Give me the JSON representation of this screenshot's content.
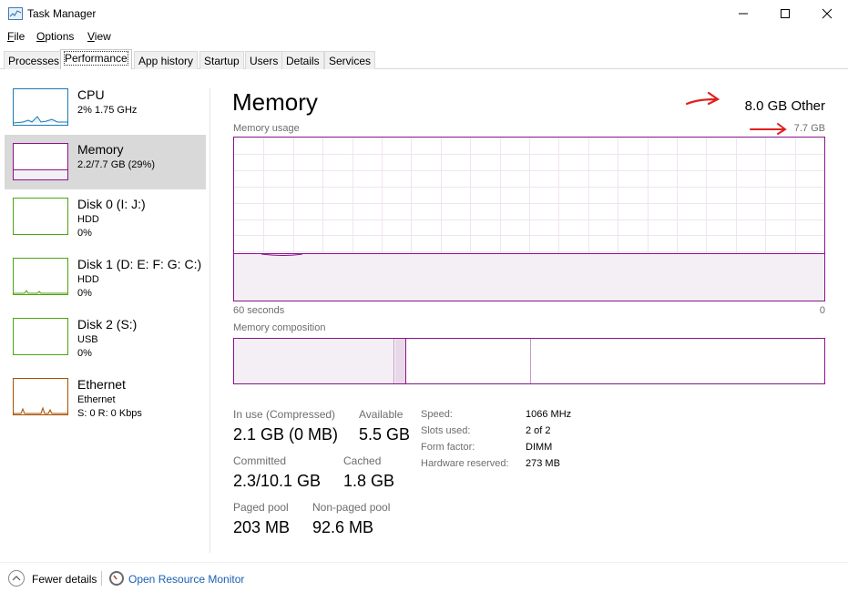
{
  "window": {
    "title": "Task Manager"
  },
  "menu": [
    {
      "label": "File",
      "key": "F",
      "rest": "ile"
    },
    {
      "label": "Options",
      "key": "O",
      "rest": "ptions"
    },
    {
      "label": "View",
      "key": "V",
      "rest": "iew"
    }
  ],
  "tabs": [
    "Processes",
    "Performance",
    "App history",
    "Startup",
    "Users",
    "Details",
    "Services"
  ],
  "active_tab": "Performance",
  "resources": [
    {
      "name": "CPU",
      "line1": "2%  1.75 GHz",
      "line2": "",
      "color": "#1a7ab5"
    },
    {
      "name": "Memory",
      "line1": "2.2/7.7 GB (29%)",
      "line2": "",
      "color": "#8b138b"
    },
    {
      "name": "Disk 0 (I: J:)",
      "line1": "HDD",
      "line2": "0%",
      "color": "#4da60c"
    },
    {
      "name": "Disk 1 (D: E: F: G: C:)",
      "line1": "HDD",
      "line2": "0%",
      "color": "#4da60c"
    },
    {
      "name": "Disk 2 (S:)",
      "line1": "USB",
      "line2": "0%",
      "color": "#4da60c"
    },
    {
      "name": "Ethernet",
      "line1": "Ethernet",
      "line2": "S: 0  R: 0 Kbps",
      "color": "#a74f01"
    }
  ],
  "main": {
    "title": "Memory",
    "total": "8.0 GB Other",
    "usage_label": "Memory usage",
    "usage_max": "7.7 GB",
    "axis_left": "60 seconds",
    "axis_right": "0",
    "composition_label": "Memory composition",
    "usage_fraction": 0.29
  },
  "stats": {
    "in_use_label": "In use (Compressed)",
    "in_use_value": "2.1 GB (0 MB)",
    "available_label": "Available",
    "available_value": "5.5 GB",
    "committed_label": "Committed",
    "committed_value": "2.3/10.1 GB",
    "cached_label": "Cached",
    "cached_value": "1.8 GB",
    "paged_label": "Paged pool",
    "paged_value": "203 MB",
    "nonpaged_label": "Non-paged pool",
    "nonpaged_value": "92.6 MB"
  },
  "specs": [
    {
      "label": "Speed:",
      "value": "1066 MHz"
    },
    {
      "label": "Slots used:",
      "value": "2 of 2"
    },
    {
      "label": "Form factor:",
      "value": "DIMM"
    },
    {
      "label": "Hardware reserved:",
      "value": "273 MB"
    }
  ],
  "footer": {
    "fewer_details": "Fewer details",
    "fewer_key": "d",
    "open_resource_monitor": "Open Resource Monitor"
  },
  "colors": {
    "memory": "#8b138b",
    "annotation": "#e02020",
    "link": "#1a5fb4"
  }
}
